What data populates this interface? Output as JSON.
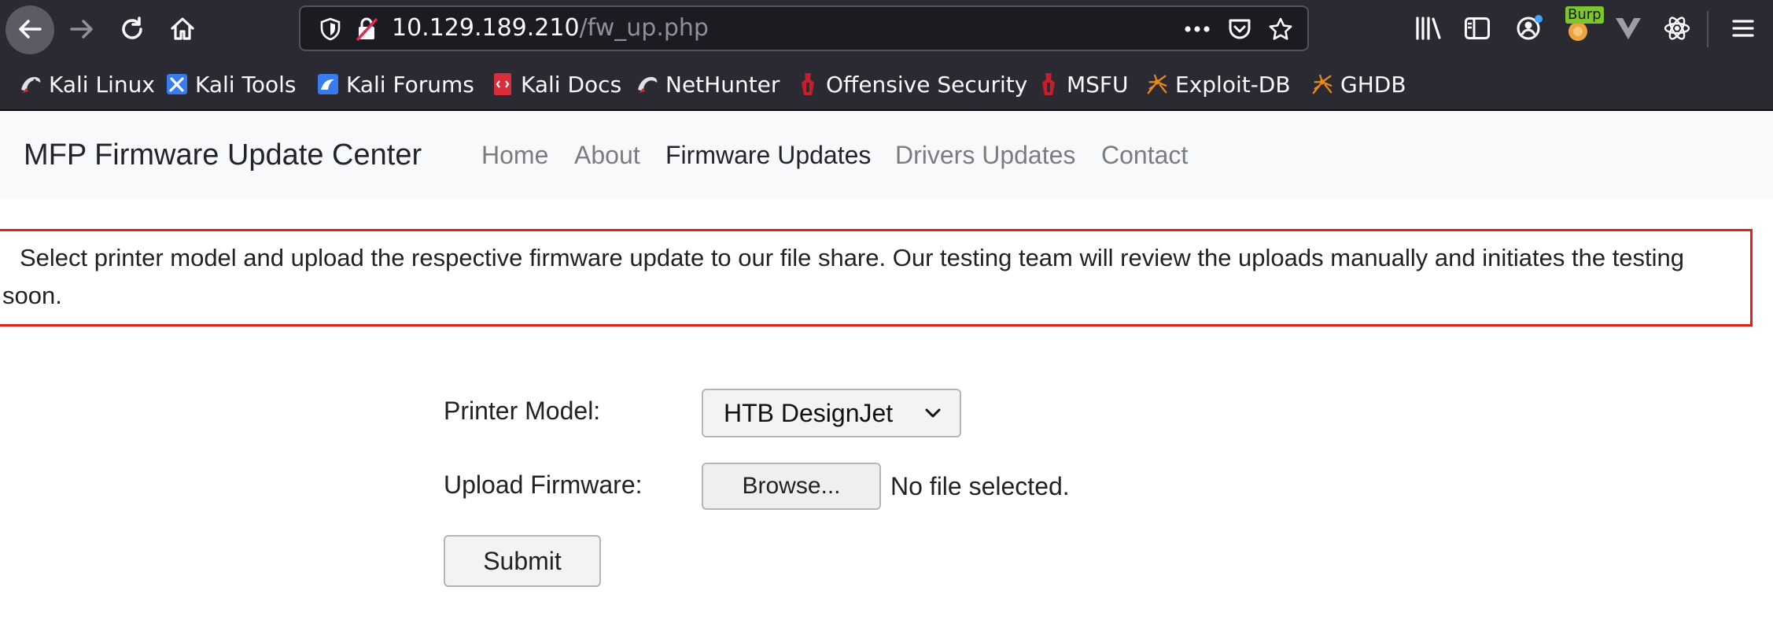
{
  "browser": {
    "url_host": "10.129.189.210",
    "url_path": "/fw_up.php",
    "burp_badge": "Burp",
    "colors": {
      "chrome": "#2b2a33",
      "urlbar": "#1c1b22",
      "text": "#fbfbfe",
      "path": "#8f8f9d"
    }
  },
  "bookmarks": [
    {
      "label": "Kali Linux",
      "icon": "kali-dragon-icon"
    },
    {
      "label": "Kali Tools",
      "icon": "kali-tools-icon"
    },
    {
      "label": "Kali Forums",
      "icon": "kali-forums-icon"
    },
    {
      "label": "Kali Docs",
      "icon": "kali-docs-icon"
    },
    {
      "label": "NetHunter",
      "icon": "nethunter-icon"
    },
    {
      "label": "Offensive Security",
      "icon": "offsec-icon"
    },
    {
      "label": "MSFU",
      "icon": "msfu-icon"
    },
    {
      "label": "Exploit-DB",
      "icon": "exploit-db-icon"
    },
    {
      "label": "GHDB",
      "icon": "ghdb-icon"
    }
  ],
  "navbar": {
    "brand": "MFP Firmware Update Center",
    "links": [
      "Home",
      "About",
      "Firmware Updates",
      "Drivers Updates",
      "Contact"
    ],
    "active": "Firmware Updates"
  },
  "notice": {
    "text": "Select printer model and upload the respective firmware update to our file share. Our testing team will review the uploads manually and initiates the testing soon.",
    "border_color": "#e0221b"
  },
  "form": {
    "printer_label": "Printer Model:",
    "printer_value": "HTB DesignJet",
    "upload_label": "Upload Firmware:",
    "browse_label": "Browse...",
    "file_status": "No file selected.",
    "submit_label": "Submit"
  }
}
